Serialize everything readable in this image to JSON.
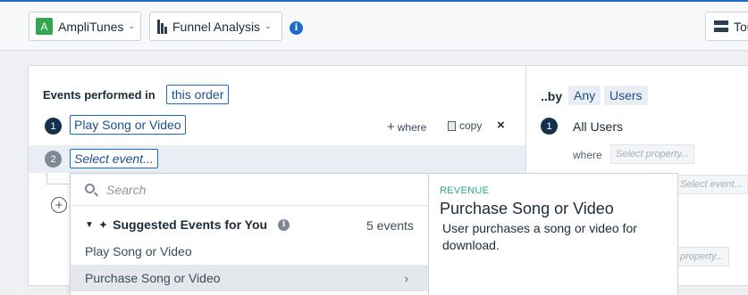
{
  "topbar": {
    "app": {
      "badge": "A",
      "name": "AmpliTunes",
      "chevron": "⌄"
    },
    "analysis": {
      "name": "Funnel Analysis",
      "chevron": "⌄"
    },
    "info_glyph": "i",
    "tour": {
      "label": "Tou"
    }
  },
  "funnel": {
    "events_label": "Events performed in",
    "order_label": "this order",
    "steps": [
      {
        "number": "1",
        "event": "Play Song or Video",
        "where_label": "where",
        "copy_label": "copy",
        "close_glyph": "×"
      },
      {
        "number": "2",
        "event": "Select event..."
      }
    ],
    "add_glyph": "+"
  },
  "segment": {
    "by_label": "..by",
    "any_label": "Any",
    "users_label": "Users",
    "rows": [
      {
        "number": "1",
        "name": "All Users",
        "where_label": "where",
        "property_placeholder": "Select property..."
      }
    ],
    "event_placeholder": "Select event...",
    "property_placeholder_2": "property..."
  },
  "dropdown": {
    "search_placeholder": "Search",
    "suggested_label": "Suggested Events for You",
    "suggested_count": "5 events",
    "items": [
      {
        "label": "Play Song or Video"
      },
      {
        "label": "Purchase Song or Video"
      }
    ]
  },
  "detail": {
    "category": "REVENUE",
    "title": "Purchase Song or Video",
    "description": "User purchases a song or video for download."
  },
  "colors": {
    "accent": "#1e6cc7",
    "app_badge": "#33a74f",
    "category": "#2aa58e",
    "step_active": "#13304d"
  }
}
